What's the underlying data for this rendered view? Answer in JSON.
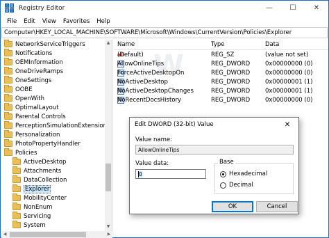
{
  "window": {
    "title": "Registry Editor",
    "buttons": {
      "minimize": "—",
      "maximize": "☐",
      "close": "✕"
    }
  },
  "menu": [
    "File",
    "Edit",
    "View",
    "Favorites",
    "Help"
  ],
  "address": "Computer\\HKEY_LOCAL_MACHINE\\SOFTWARE\\Microsoft\\Windows\\CurrentVersion\\Policies\\Explorer",
  "tree": {
    "items": [
      {
        "label": "NetworkServiceTriggers"
      },
      {
        "label": "Notifications"
      },
      {
        "label": "OEMInformation"
      },
      {
        "label": "OneDriveRamps"
      },
      {
        "label": "OneSettings"
      },
      {
        "label": "OOBE"
      },
      {
        "label": "OpenWith"
      },
      {
        "label": "OptimalLayout"
      },
      {
        "label": "Parental Controls"
      },
      {
        "label": "PerceptionSimulationExtensions"
      },
      {
        "label": "Personalization"
      },
      {
        "label": "PhotoPropertyHandler"
      },
      {
        "label": "Policies"
      },
      {
        "label": "ActiveDesktop"
      },
      {
        "label": "Attachments"
      },
      {
        "label": "DataCollection"
      },
      {
        "label": "Explorer"
      },
      {
        "label": "MobilityCenter"
      },
      {
        "label": "NonEnum"
      },
      {
        "label": "Servicing"
      },
      {
        "label": "System"
      }
    ]
  },
  "values": {
    "headers": {
      "name": "Name",
      "type": "Type",
      "data": "Data"
    },
    "rows": [
      {
        "name": "(Default)",
        "type": "REG_SZ",
        "data": "(value not set)",
        "icon": "string-value-icon"
      },
      {
        "name": "AllowOnlineTips",
        "type": "REG_DWORD",
        "data": "0x00000000 (0)",
        "icon": "dword-value-icon"
      },
      {
        "name": "ForceActiveDesktopOn",
        "type": "REG_DWORD",
        "data": "0x00000000 (0)",
        "icon": "dword-value-icon"
      },
      {
        "name": "NoActiveDesktop",
        "type": "REG_DWORD",
        "data": "0x00000001 (1)",
        "icon": "dword-value-icon"
      },
      {
        "name": "NoActiveDesktopChanges",
        "type": "REG_DWORD",
        "data": "0x00000001 (1)",
        "icon": "dword-value-icon"
      },
      {
        "name": "NoRecentDocsHistory",
        "type": "REG_DWORD",
        "data": "0x00000000 (0)",
        "icon": "dword-value-icon"
      }
    ]
  },
  "dialog": {
    "title": "Edit DWORD (32-bit) Value",
    "close": "✕",
    "value_name_label": "Value name:",
    "value_name": "AllowOnlineTips",
    "value_data_label": "Value data:",
    "value_data": "0",
    "base_label": "Base",
    "base_options": [
      "Hexadecimal",
      "Decimal"
    ],
    "base_selected": "Hexadecimal",
    "ok": "OK",
    "cancel": "Cancel"
  },
  "watermark": "http://winaero.com"
}
